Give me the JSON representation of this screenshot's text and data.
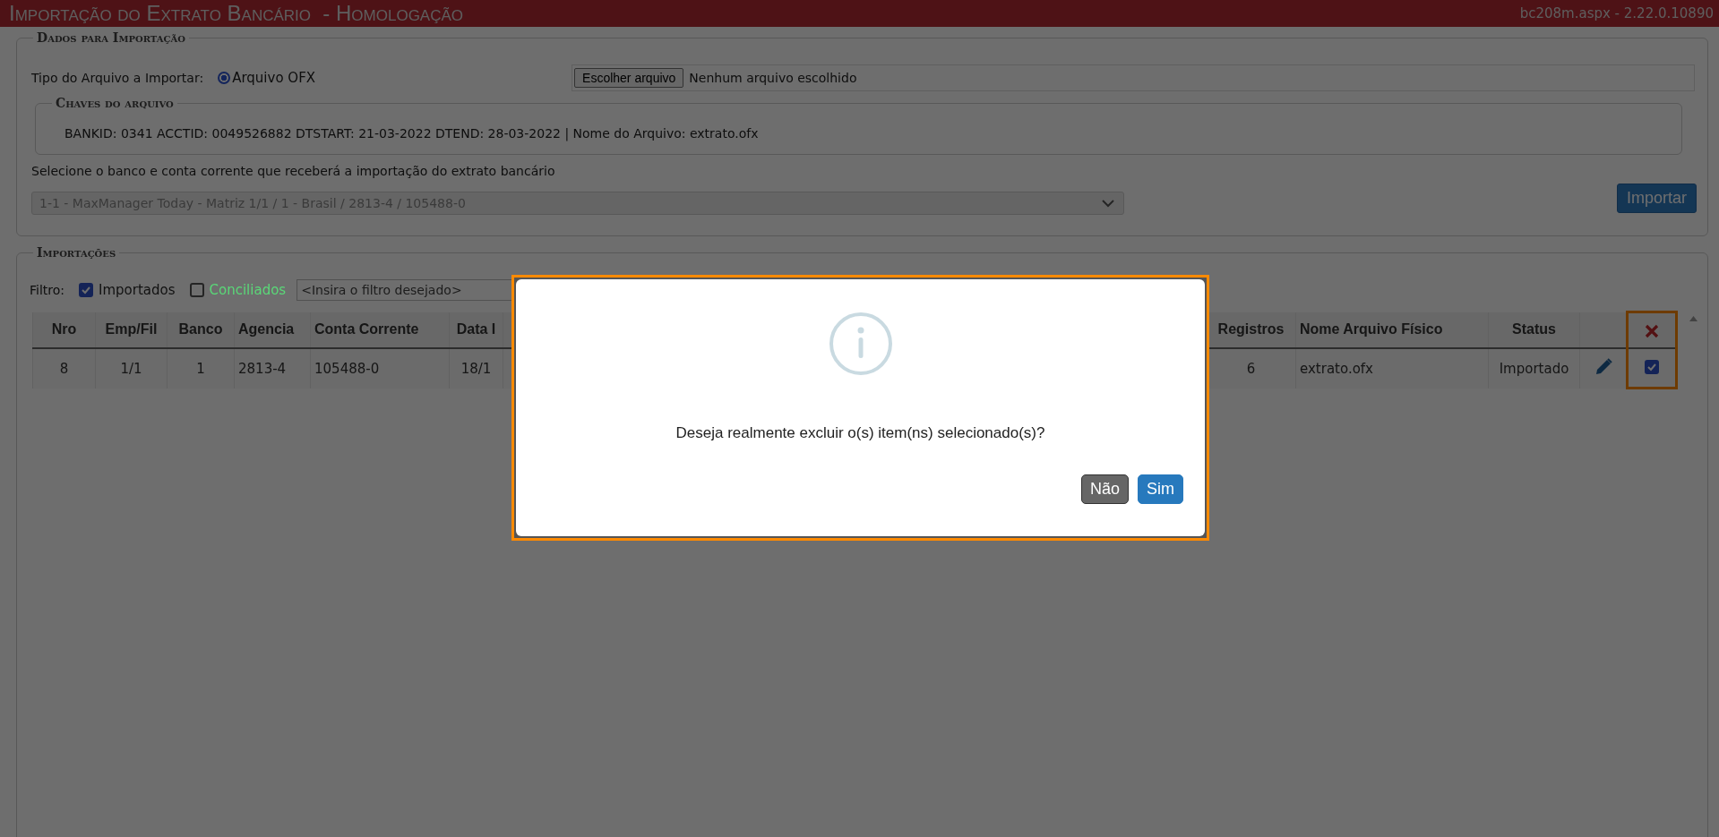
{
  "header": {
    "title": "Importação do Extrato Bancário  - Homologação",
    "version": "bc208m.aspx - 2.22.0.10890"
  },
  "import_data": {
    "legend": "Dados para Importação",
    "file_type_label": "Tipo do Arquivo a Importar:",
    "file_type_options": [
      {
        "label": "Arquivo OFX",
        "selected": true
      }
    ],
    "file_button": "Escolher arquivo",
    "file_status": "Nenhum arquivo escolhido",
    "file_keys": {
      "legend": "Chaves do arquivo",
      "text": "BANKID: 0341 ACCTID: 0049526882 DTSTART: 21-03-2022 DTEND: 28-03-2022 | Nome do Arquivo: extrato.ofx"
    },
    "account_label": "Selecione o banco e conta corrente que receberá a importação do extrato bancário",
    "account_select": {
      "value": "1-1 - MaxManager Today - Matriz 1/1 / 1 - Brasil / 2813-4 / 105488-0",
      "disabled": true
    },
    "import_button": "Importar"
  },
  "imports": {
    "legend": "Importações",
    "filter_label": "Filtro:",
    "filters": [
      {
        "label": "Importados",
        "checked": true,
        "color": "#111111"
      },
      {
        "label": "Conciliados",
        "checked": false,
        "color": "#5ad878"
      }
    ],
    "filter_placeholder": "<Insira o filtro desejado>",
    "columns": [
      "Nro",
      "Emp/Fil",
      "Banco",
      "Agencia",
      "Conta Corrente",
      "Data I",
      "",
      "Registros",
      "Nome Arquivo Físico",
      "Status"
    ],
    "rows": [
      {
        "cells": [
          "8",
          "1/1",
          "1",
          "2813-4",
          "105488-0",
          "18/1",
          "",
          "6",
          "extrato.ofx",
          "Importado"
        ],
        "checked": true
      }
    ]
  },
  "dialog": {
    "message": "Deseja realmente excluir o(s) item(ns) selecionado(s)?",
    "buttons": [
      {
        "label": "Não",
        "kind": "secondary"
      },
      {
        "label": "Sim",
        "kind": "primary"
      }
    ]
  }
}
